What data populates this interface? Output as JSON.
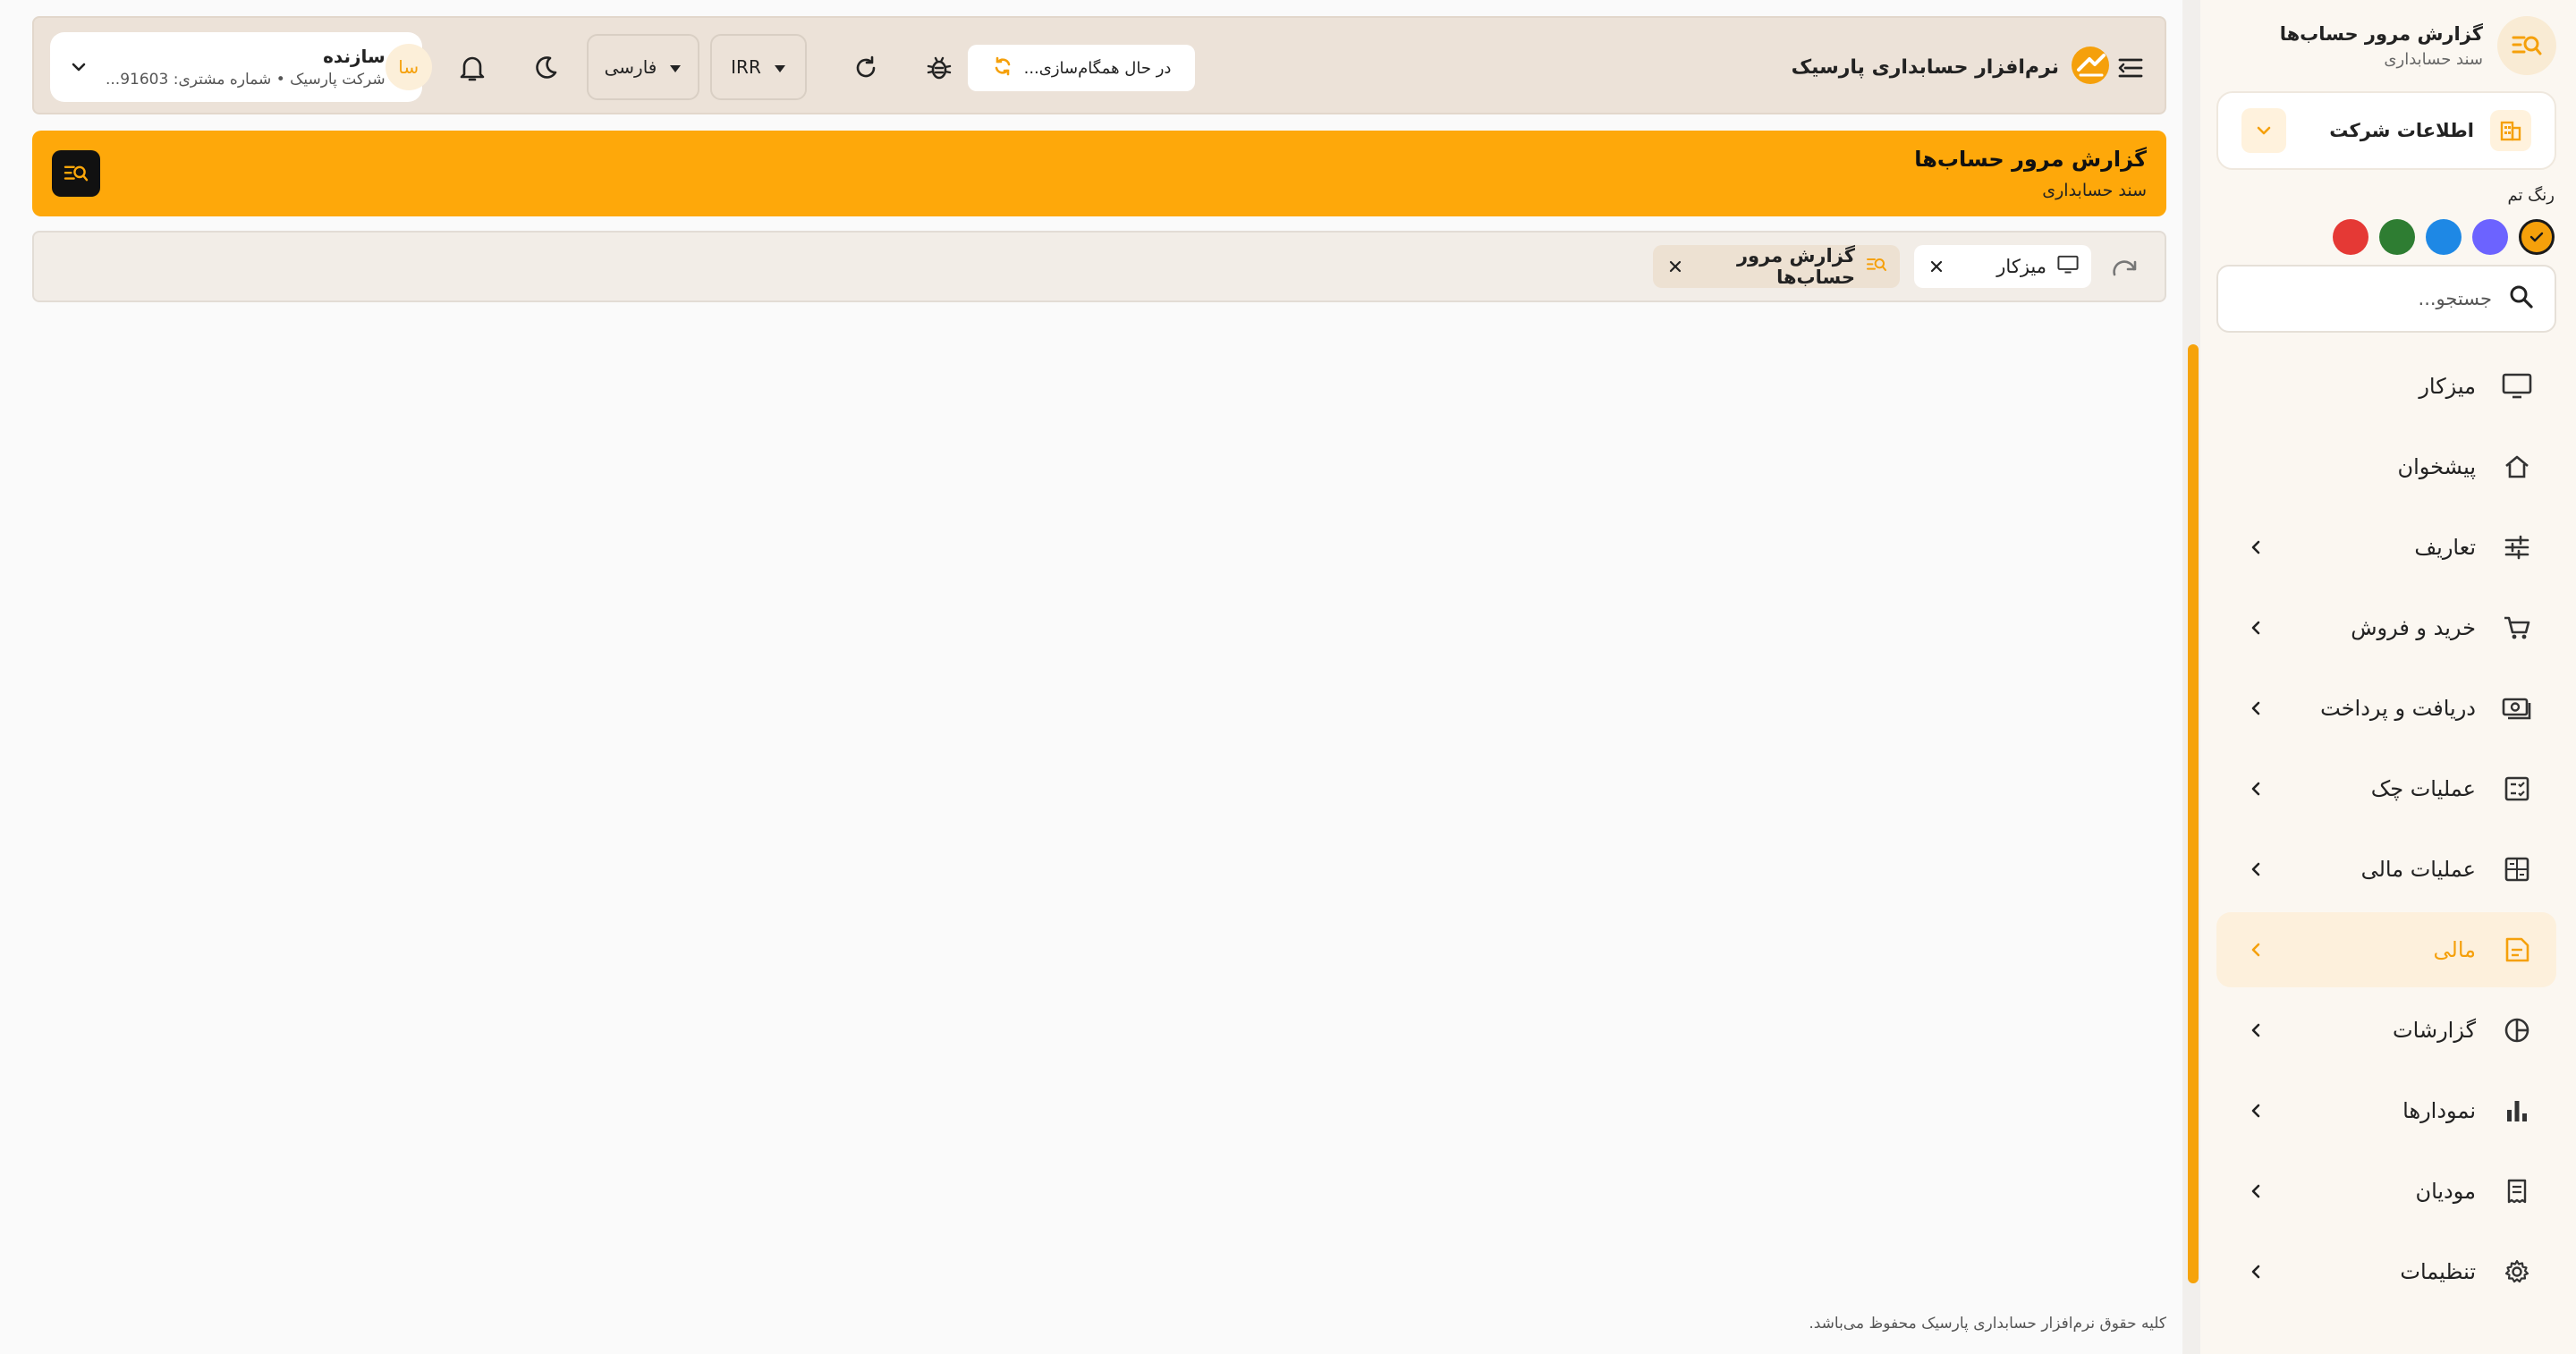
{
  "sidebar": {
    "title": "گزارش مرور حساب‌ها",
    "subtitle": "سند حسابداری",
    "company_label": "اطلاعات شرکت",
    "theme_label": "رنگ تم",
    "theme_colors": [
      "#f5a00b",
      "#6c63ff",
      "#1e88e5",
      "#2e7d32",
      "#e53935"
    ],
    "search_placeholder": "جستجو...",
    "items": [
      {
        "label": "میزکار",
        "icon": "monitor-icon",
        "has_children": false
      },
      {
        "label": "پیشخوان",
        "icon": "home-icon",
        "has_children": false
      },
      {
        "label": "تعاریف",
        "icon": "sliders-icon",
        "has_children": true
      },
      {
        "label": "خرید و فروش",
        "icon": "cart-icon",
        "has_children": true
      },
      {
        "label": "دریافت و پرداخت",
        "icon": "money-icon",
        "has_children": true
      },
      {
        "label": "عملیات چک",
        "icon": "check-list-icon",
        "has_children": true
      },
      {
        "label": "عملیات مالی",
        "icon": "calculator-icon",
        "has_children": true
      },
      {
        "label": "مالی",
        "icon": "ledger-icon",
        "has_children": true,
        "active": true
      },
      {
        "label": "گزارشات",
        "icon": "pie-chart-icon",
        "has_children": true
      },
      {
        "label": "نمودارها",
        "icon": "bar-chart-icon",
        "has_children": true
      },
      {
        "label": "مودیان",
        "icon": "receipt-icon",
        "has_children": true
      },
      {
        "label": "تنظیمات",
        "icon": "gear-icon",
        "has_children": true
      }
    ]
  },
  "header": {
    "app_name": "نرم‌افزار حسابداری پارسیک",
    "sync_status": "در حال همگام‌سازی...",
    "currency": "IRR",
    "language": "فارسی",
    "user": {
      "avatar_initials": "سا",
      "name": "سازنده",
      "subtitle": "شرکت پارسیک • شماره مشتری: 91603..."
    }
  },
  "banner": {
    "title": "گزارش مرور حساب‌ها",
    "subtitle": "سند حسابداری"
  },
  "tabs": [
    {
      "label": "میزکار",
      "icon": "monitor-icon"
    },
    {
      "label": "گزارش مرور حساب‌ها",
      "icon": "report-search-icon"
    }
  ],
  "footer": {
    "copyright": "کلیه حقوق نرم‌افزار حسابداری پارسیک محفوظ می‌باشد."
  },
  "colors": {
    "accent": "#f5a00b",
    "banner": "#fea80a",
    "topbar": "#ece2d8"
  }
}
